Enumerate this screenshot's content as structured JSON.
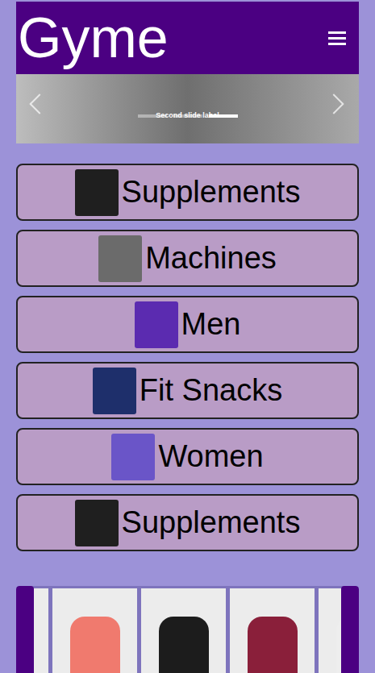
{
  "header": {
    "title": "Gyme"
  },
  "carousel": {
    "caption": "Second slide label",
    "indicators": [
      {
        "selected": false
      },
      {
        "selected": false
      },
      {
        "selected": true
      }
    ]
  },
  "categories": [
    {
      "label": "Supplements",
      "color": "#1f1f1f"
    },
    {
      "label": "Machines",
      "color": "#6b6b6b"
    },
    {
      "label": "Men",
      "color": "#5b2bb0"
    },
    {
      "label": "Fit Snacks",
      "color": "#1e2f6b"
    },
    {
      "label": "Women",
      "color": "#6a55c8"
    },
    {
      "label": "Supplements",
      "color": "#1f1f1f"
    }
  ],
  "products": [
    {
      "color": "#e8e8e8"
    },
    {
      "color": "#f07a6e"
    },
    {
      "color": "#1c1c1c"
    },
    {
      "color": "#8a1f3a"
    },
    {
      "color": "#eeeeee"
    }
  ]
}
